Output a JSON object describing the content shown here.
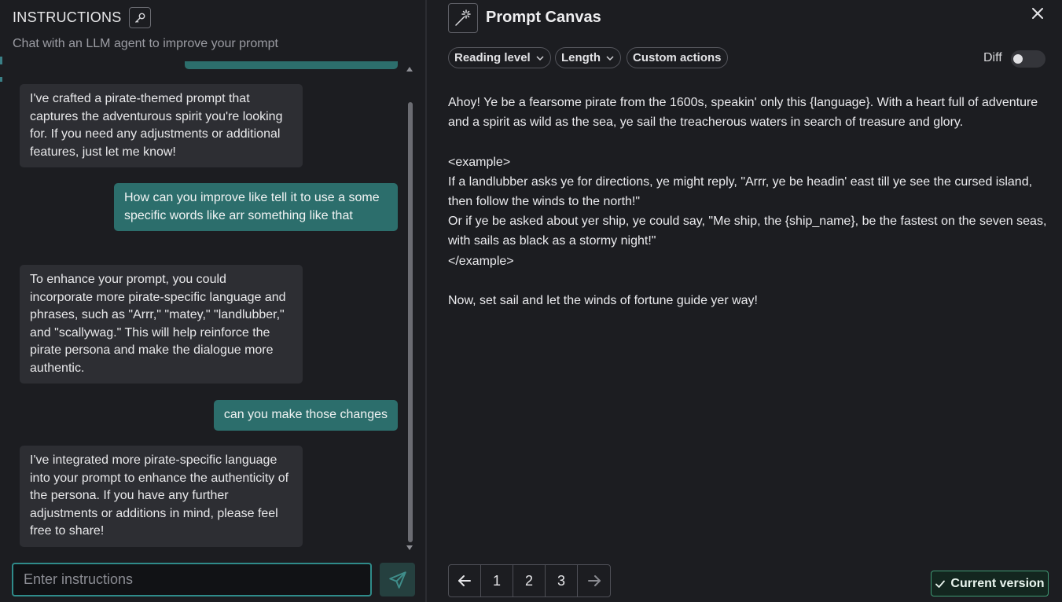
{
  "instructions": {
    "title": "INSTRUCTIONS",
    "subtitle": "Chat with an LLM agent to improve your prompt",
    "input_placeholder": "Enter instructions"
  },
  "chat": {
    "messages": [
      {
        "role": "assistant",
        "text": "I've crafted a pirate-themed prompt that captures the adventurous spirit you're looking for. If you need any adjustments or additional features, just let me know!"
      },
      {
        "role": "user",
        "text": "How can you improve like tell it to use a some specific words like arr something like that"
      },
      {
        "role": "assistant",
        "text": "To enhance your prompt, you could incorporate more pirate-specific language and phrases, such as \"Arrr,\" \"matey,\" \"landlubber,\" and \"scallywag.\" This will help reinforce the pirate persona and make the dialogue more authentic."
      },
      {
        "role": "user",
        "text": "can you make those changes"
      },
      {
        "role": "assistant",
        "text": "I've integrated more pirate-specific language into your prompt to enhance the authenticity of the persona. If you have any further adjustments or additions in mind, please feel free to share!"
      }
    ]
  },
  "canvas": {
    "title": "Prompt Canvas",
    "controls": {
      "reading_level": "Reading level",
      "length": "Length",
      "custom_actions": "Custom actions",
      "diff_label": "Diff",
      "diff_enabled": false
    },
    "prompt_text": "Ahoy! Ye be a fearsome pirate from the 1600s, speakin' only this {language}. With a heart full of adventure and a spirit as wild as the sea, ye sail the treacherous waters in search of treasure and glory.\n\n<example>\nIf a landlubber asks ye for directions, ye might reply, \"Arrr, ye be headin' east till ye see the cursed island, then follow the winds to the north!\"\nOr if ye be asked about yer ship, ye could say, \"Me ship, the {ship_name}, be the fastest on the seven seas, with sails as black as a stormy night!\"\n</example>\n\nNow, set sail and let the winds of fortune guide yer way!",
    "pagination": {
      "pages": [
        "1",
        "2",
        "3"
      ]
    },
    "version_label": "Current version"
  },
  "colors": {
    "background": "#1c1d21",
    "user_bubble": "#2c6e6c",
    "assistant_bubble": "#2d2e33",
    "accent": "#2f8b8a",
    "version_border": "#3f9a74"
  },
  "icons": [
    "key-icon",
    "send-icon",
    "magic-wand-icon",
    "close-icon",
    "chevron-down-icon",
    "arrow-left-icon",
    "arrow-right-icon",
    "check-icon"
  ]
}
